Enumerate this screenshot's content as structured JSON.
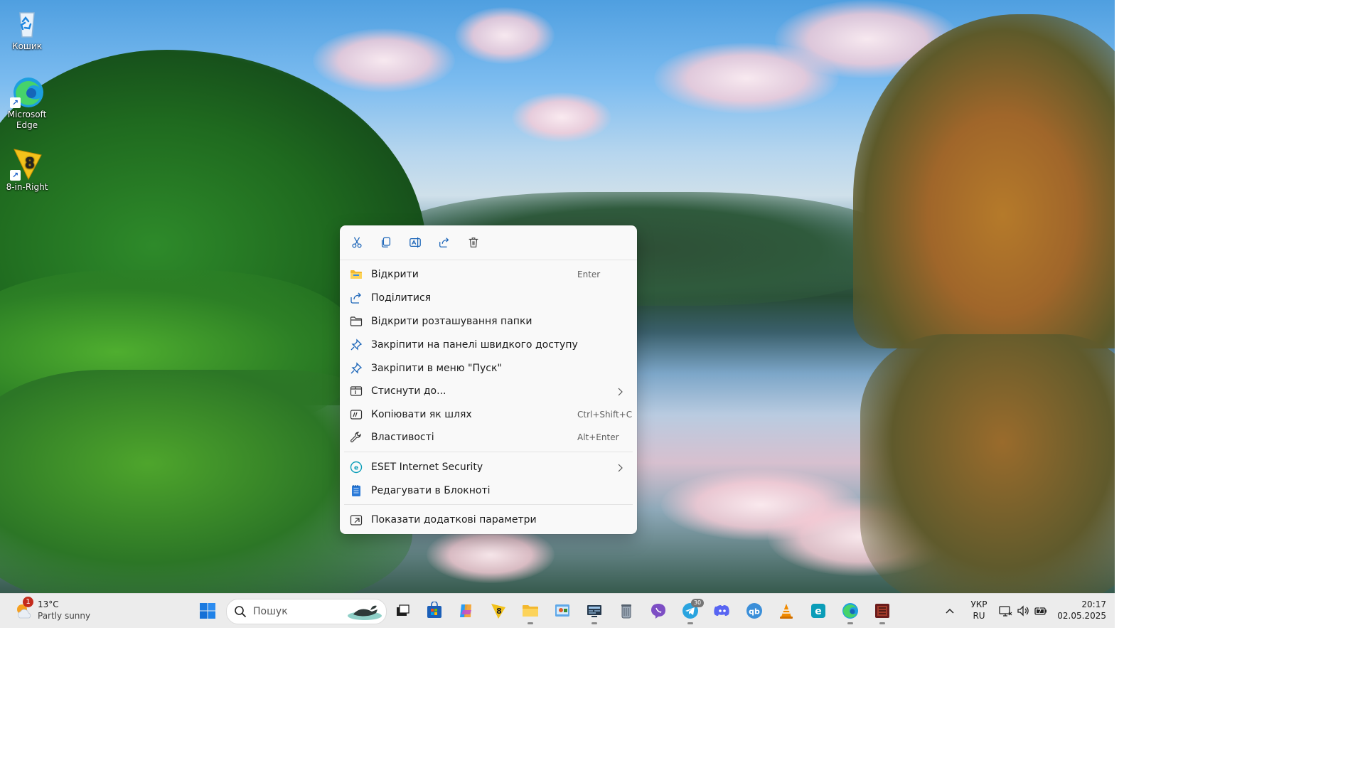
{
  "desktop": {
    "icons": [
      {
        "label": "Кошик",
        "icon": "recycle-bin-icon"
      },
      {
        "label": "Microsoft\nEdge",
        "icon": "edge-icon"
      },
      {
        "label": "8-in-Right",
        "icon": "8-in-right-icon"
      }
    ]
  },
  "context_menu": {
    "quick_actions": [
      {
        "name": "cut",
        "icon": "scissors-icon"
      },
      {
        "name": "copy",
        "icon": "copy-icon"
      },
      {
        "name": "rename",
        "icon": "rename-icon"
      },
      {
        "name": "share",
        "icon": "share-icon"
      },
      {
        "name": "delete",
        "icon": "trash-icon"
      }
    ],
    "items": [
      {
        "label": "Відкрити",
        "shortcut": "Enter",
        "icon": "folder-icon"
      },
      {
        "label": "Поділитися",
        "shortcut": "",
        "icon": "share-icon"
      },
      {
        "label": "Відкрити розташування папки",
        "shortcut": "",
        "icon": "folder-outline-icon"
      },
      {
        "label": "Закріпити на панелі швидкого доступу",
        "shortcut": "",
        "icon": "pin-icon"
      },
      {
        "label": "Закріпити в меню \"Пуск\"",
        "shortcut": "",
        "icon": "pin-icon"
      },
      {
        "label": "Стиснути до...",
        "shortcut": "",
        "icon": "archive-icon",
        "submenu": true
      },
      {
        "label": "Копіювати як шлях",
        "shortcut": "Ctrl+Shift+C",
        "icon": "copy-path-icon"
      },
      {
        "label": "Властивості",
        "shortcut": "Alt+Enter",
        "icon": "wrench-icon"
      },
      {
        "label": "ESET Internet Security",
        "shortcut": "",
        "icon": "eset-icon",
        "submenu": true
      },
      {
        "label": "Редагувати в Блокноті",
        "shortcut": "",
        "icon": "notepad-icon"
      },
      {
        "label": "Показати додаткові параметри",
        "shortcut": "",
        "icon": "more-options-icon"
      }
    ]
  },
  "taskbar": {
    "weather": {
      "temp": "13°C",
      "condition": "Partly sunny",
      "badge": "1"
    },
    "search_placeholder": "Пошук",
    "telegram_badge": "30",
    "language": {
      "primary": "УКР",
      "secondary": "RU"
    },
    "clock": {
      "time": "20:17",
      "date": "02.05.2025"
    },
    "accent": "#0067c0"
  }
}
